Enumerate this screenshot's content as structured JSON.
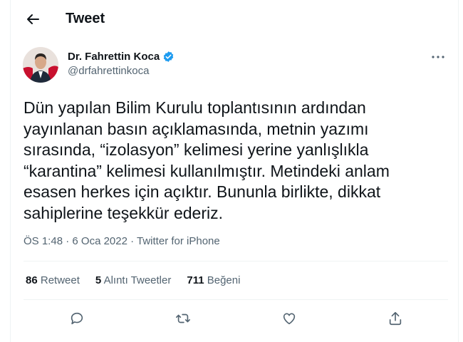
{
  "header": {
    "title": "Tweet",
    "back_icon": "arrow-left-icon"
  },
  "author": {
    "display_name": "Dr. Fahrettin Koca",
    "handle": "@drfahrettinkoca",
    "verified": true,
    "avatar_icon": "profile-photo"
  },
  "tweet": {
    "text": "Dün yapılan Bilim Kurulu toplantısının ardından\nyayınlanan basın açıklamasında, metnin yazımı\nsırasında, “izolasyon” kelimesi yerine yanlışlıkla\n“karantina” kelimesi kullanılmıştır. Metindeki anlam\nesasen herkes için açıktır. Bununla birlikte, dikkat\nsahiplerine teşekkür ederiz.",
    "time": "ÖS 1:48",
    "date": "6 Oca 2022",
    "source": "Twitter for iPhone",
    "separator": " · "
  },
  "stats": {
    "retweets": {
      "count": "86",
      "label": "Retweet"
    },
    "quotes": {
      "count": "5",
      "label": "Alıntı Tweetler"
    },
    "likes": {
      "count": "711",
      "label": "Beğeni"
    }
  },
  "actions": [
    "reply-icon",
    "retweet-icon",
    "like-icon",
    "share-icon"
  ],
  "colors": {
    "text": "#0f1419",
    "secondary": "#536471",
    "verified": "#1d9bf0",
    "divider": "#eff3f4"
  }
}
